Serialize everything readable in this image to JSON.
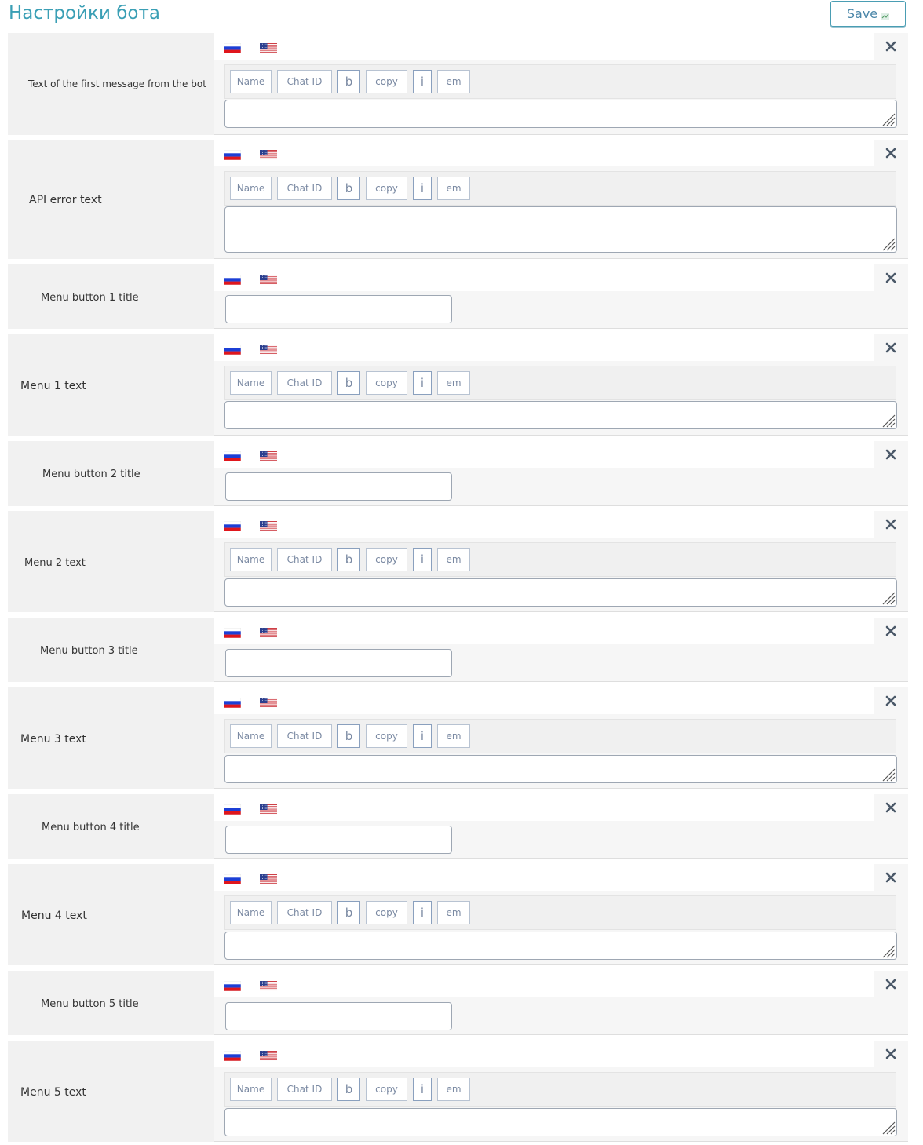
{
  "page": {
    "title": "Настройки бота",
    "save_label": "Save",
    "accent_color": "#3a9fb5"
  },
  "languages": [
    "ru",
    "en-US"
  ],
  "toolbar_buttons": [
    "Name",
    "Chat ID",
    "b",
    "copy",
    "i",
    "em"
  ],
  "fields": [
    {
      "label": "Text of the first message from the bot",
      "kind": "text"
    },
    {
      "label": "API error text",
      "kind": "text"
    },
    {
      "label": "Menu button 1 title",
      "kind": "title"
    },
    {
      "label": "Menu 1 text",
      "kind": "text"
    },
    {
      "label": "Menu button 2 title",
      "kind": "title"
    },
    {
      "label": "Menu 2 text",
      "kind": "text"
    },
    {
      "label": "Menu button 3 title",
      "kind": "title"
    },
    {
      "label": "Menu 3 text",
      "kind": "text"
    },
    {
      "label": "Menu button 4 title",
      "kind": "title"
    },
    {
      "label": "Menu 4 text",
      "kind": "text"
    },
    {
      "label": "Menu button 5 title",
      "kind": "title"
    },
    {
      "label": "Menu 5 text",
      "kind": "text"
    }
  ],
  "icons": {
    "close": "close-icon",
    "ru_flag": "russia-flag-icon",
    "us_flag": "usa-flag-icon",
    "resize": "resize-grip-icon"
  }
}
